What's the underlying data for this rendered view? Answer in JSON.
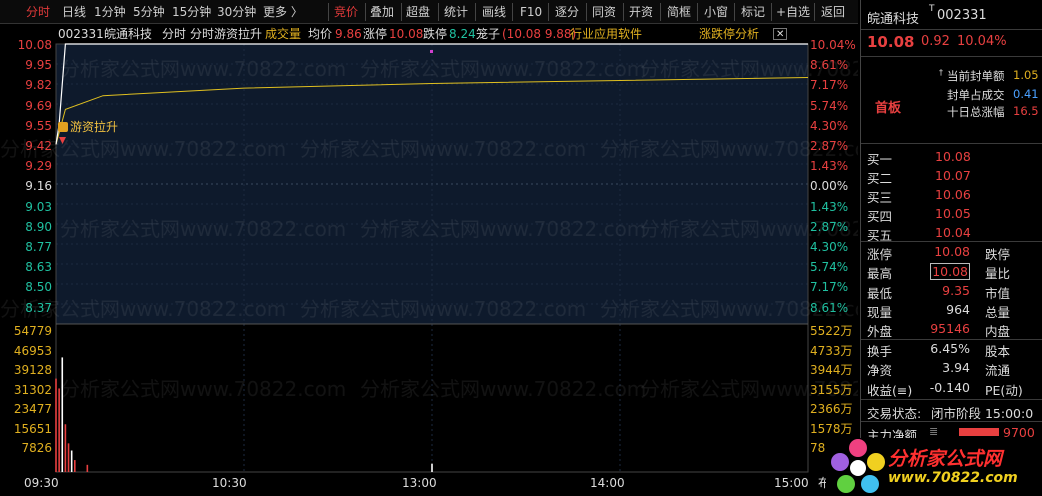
{
  "toolbar": {
    "items": [
      "分时",
      "日线",
      "1分钟",
      "5分钟",
      "15分钟",
      "30分钟",
      "更多 〉",
      "竞价",
      "叠加",
      "超盘",
      "统计",
      "画线",
      "F10",
      "逐分",
      "同资",
      "开资",
      "简框",
      "小窗",
      "标记",
      "+自选",
      "返回"
    ]
  },
  "header": {
    "code": "002331",
    "name": "皖通科技",
    "mode": "分时",
    "title": "分时游资拉升",
    "vol_label": "成交量",
    "avg_label": "均价",
    "avg_value": "9.86",
    "limit_up_label": "涨停",
    "limit_up_value": "10.08",
    "limit_down_label": "跌停",
    "limit_down_value": "8.24",
    "bid_ask_label": "笼子",
    "bid_ask_value": "(10.08 9.88)",
    "industry": "行业应用软件",
    "analysis_link": "涨跌停分析"
  },
  "price_axis": [
    "10.08",
    "9.95",
    "9.82",
    "9.69",
    "9.55",
    "9.42",
    "9.29",
    "9.16",
    "9.03",
    "8.90",
    "8.77",
    "8.63",
    "8.50",
    "8.37"
  ],
  "pct_axis": [
    "10.04%",
    "8.61%",
    "7.17%",
    "5.74%",
    "4.30%",
    "2.87%",
    "1.43%",
    "0.00%",
    "1.43%",
    "2.87%",
    "4.30%",
    "5.74%",
    "7.17%",
    "8.61%"
  ],
  "vol_axis_left": [
    "54779",
    "46953",
    "39128",
    "31302",
    "23477",
    "15651",
    "7826"
  ],
  "vol_axis_right": [
    "5522万",
    "4733万",
    "3944万",
    "3155万",
    "2366万",
    "1578万",
    "789"
  ],
  "time_axis": [
    "09:30",
    "10:30",
    "13:00",
    "14:00",
    "15:00"
  ],
  "time_axis_extra": "布",
  "annotation": "游资拉升",
  "watermark": "分析家公式网www.70822.com",
  "chart_data": {
    "type": "line",
    "prev_close": 9.16,
    "ylim": [
      8.24,
      10.08
    ],
    "price_series": [
      {
        "t": "09:30",
        "price": 9.42
      },
      {
        "t": "09:31",
        "price": 9.55
      },
      {
        "t": "09:33",
        "price": 10.08
      },
      {
        "t": "15:00",
        "price": 10.08
      }
    ],
    "avg_series": [
      {
        "t": "09:30",
        "price": 9.42
      },
      {
        "t": "09:33",
        "price": 9.65
      },
      {
        "t": "09:45",
        "price": 9.74
      },
      {
        "t": "10:30",
        "price": 9.79
      },
      {
        "t": "13:00",
        "price": 9.82
      },
      {
        "t": "15:00",
        "price": 9.86
      }
    ],
    "volume": [
      {
        "t": "09:30",
        "v": 39128
      },
      {
        "t": "09:31",
        "v": 35000
      },
      {
        "t": "09:32",
        "v": 48000
      },
      {
        "t": "09:33",
        "v": 20000
      },
      {
        "t": "09:34",
        "v": 12000
      },
      {
        "t": "09:35",
        "v": 9000
      },
      {
        "t": "09:36",
        "v": 5000
      },
      {
        "t": "09:40",
        "v": 3000
      },
      {
        "t": "13:00",
        "v": 3500
      }
    ],
    "colors": {
      "price": "#ffffff",
      "avg": "#e0c020",
      "vol_up": "#e84040",
      "vol_neutral": "#ffffff"
    }
  },
  "panel": {
    "name": "皖通科技",
    "code": "002331",
    "price": "10.08",
    "change": "0.92",
    "change_pct": "10.04%",
    "seal_label": "当前封单额",
    "seal_value": "1.05",
    "seal_ratio_label": "封单占成交",
    "seal_ratio_value": "0.41",
    "ten_day_label": "十日总涨幅",
    "ten_day_value": "16.5",
    "badge": "首板",
    "bids": [
      {
        "label": "买一",
        "price": "10.08"
      },
      {
        "label": "买二",
        "price": "10.07"
      },
      {
        "label": "买三",
        "price": "10.06"
      },
      {
        "label": "买四",
        "price": "10.05"
      },
      {
        "label": "买五",
        "price": "10.04"
      }
    ],
    "stats": [
      {
        "l1": "涨停",
        "v1": "10.08",
        "l2": "跌停"
      },
      {
        "l1": "最高",
        "v1": "10.08",
        "l2": "量比"
      },
      {
        "l1": "最低",
        "v1": "9.35",
        "l2": "市值"
      },
      {
        "l1": "现量",
        "v1": "964",
        "l2": "总量"
      },
      {
        "l1": "外盘",
        "v1": "95146",
        "l2": "内盘"
      }
    ],
    "stats2": [
      {
        "l1": "换手",
        "v1": "6.45%",
        "l2": "股本"
      },
      {
        "l1": "净资",
        "v1": "3.94",
        "l2": "流通"
      },
      {
        "l1": "收益(≡)",
        "v1": "-0.140",
        "l2": "PE(动)"
      }
    ],
    "trade_state_label": "交易状态:",
    "trade_state_value": "闭市阶段 15:00:0",
    "main_flow_label": "主力净额",
    "main_flow_value": "9700",
    "logo_text": "分析家公式网",
    "logo_url": "www.70822.com"
  }
}
